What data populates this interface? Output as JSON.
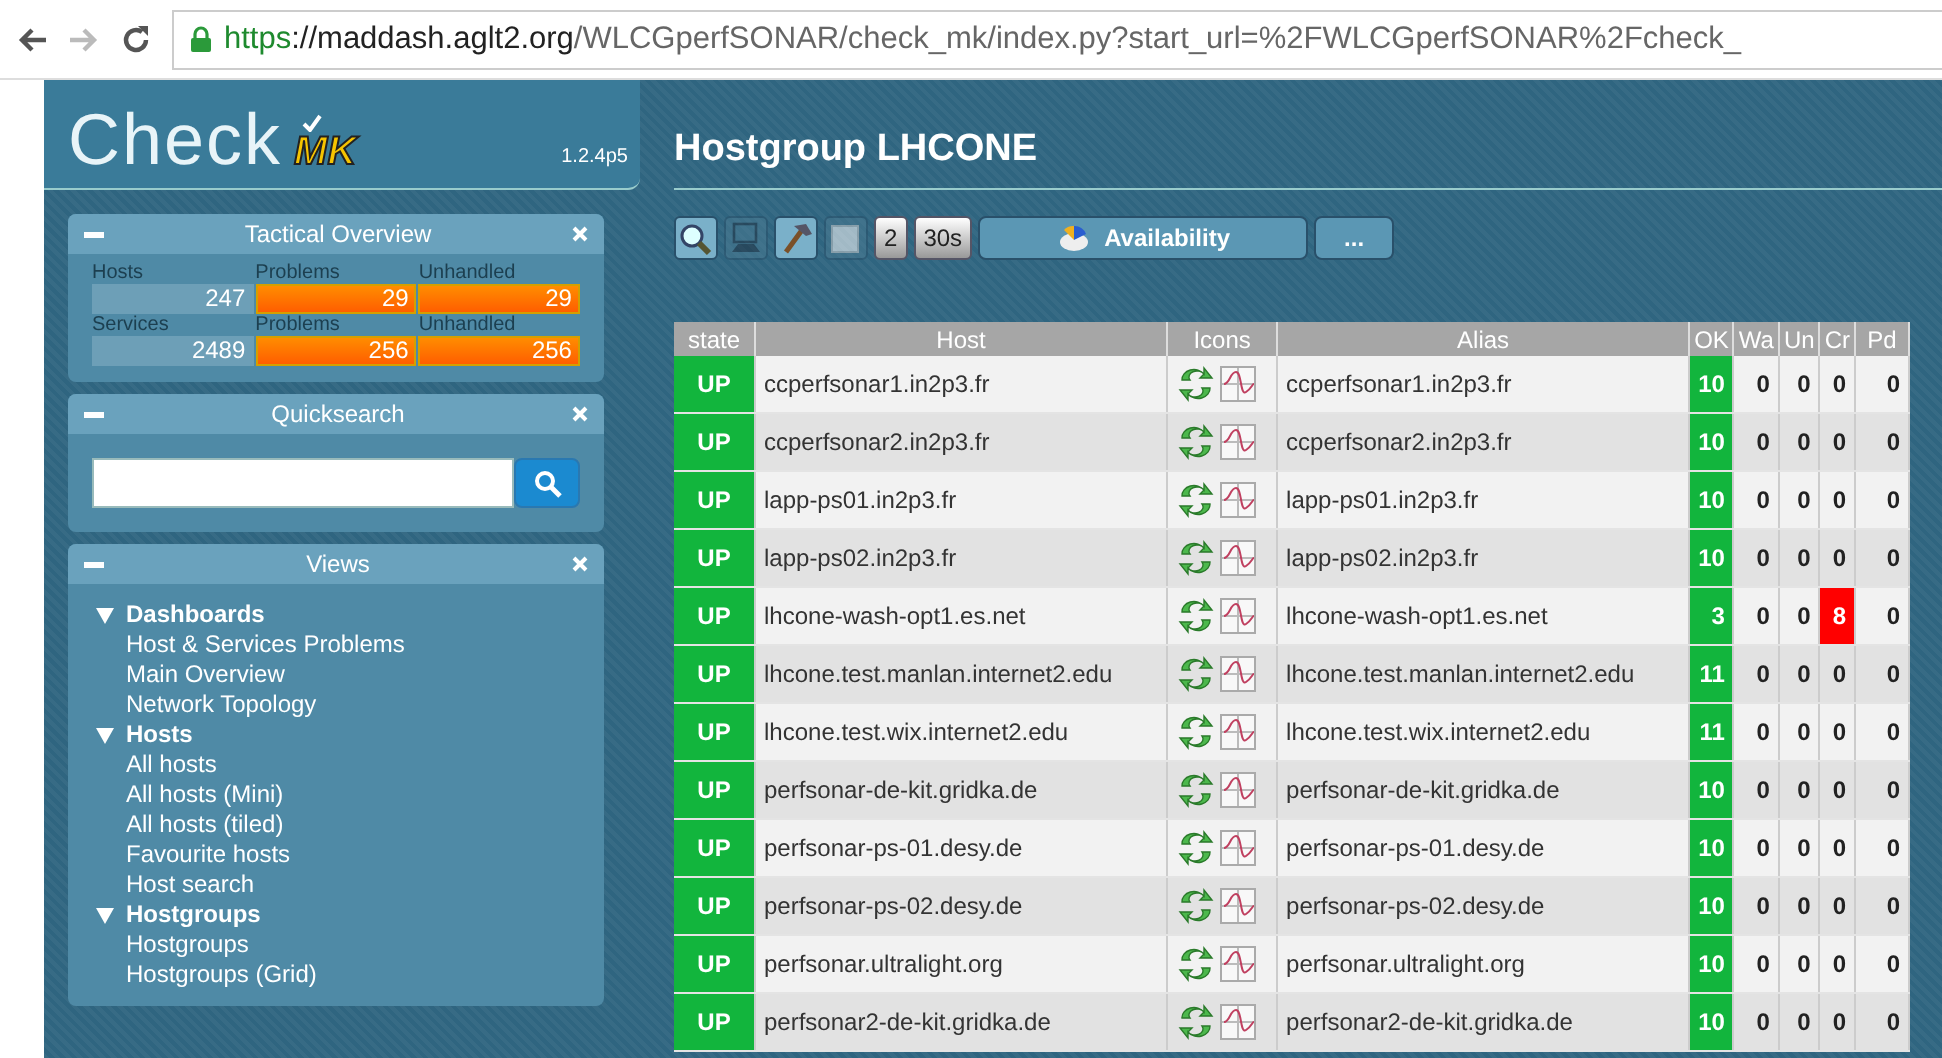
{
  "browser": {
    "back_disabled": false,
    "forward_disabled": true,
    "url": {
      "scheme": "https",
      "host": "://maddash.aglt2.org",
      "path": "/WLCGperfSONAR/check_mk/index.py?start_url=%2FWLCGperfSONAR%2Fcheck_"
    }
  },
  "logo": {
    "word": "Check",
    "mark": "MK",
    "version": "1.2.4p5"
  },
  "page_title": "Hostgroup LHCONE",
  "sidebar": {
    "tactical_overview": {
      "title": "Tactical Overview",
      "rows": [
        {
          "labels": [
            "Hosts",
            "Problems",
            "Unhandled"
          ],
          "cells": [
            {
              "value": "247",
              "alert": false
            },
            {
              "value": "29",
              "alert": true
            },
            {
              "value": "29",
              "alert": true
            }
          ]
        },
        {
          "labels": [
            "Services",
            "Problems",
            "Unhandled"
          ],
          "cells": [
            {
              "value": "2489",
              "alert": false
            },
            {
              "value": "256",
              "alert": true
            },
            {
              "value": "256",
              "alert": true
            }
          ]
        }
      ]
    },
    "quicksearch": {
      "title": "Quicksearch"
    },
    "views": {
      "title": "Views",
      "groups": [
        {
          "label": "Dashboards",
          "expanded": true,
          "children": [
            "Host & Services Problems",
            "Main Overview",
            "Network Topology"
          ]
        },
        {
          "label": "Hosts",
          "expanded": true,
          "children": [
            "All hosts",
            "All hosts (Mini)",
            "All hosts (tiled)",
            "Favourite hosts",
            "Host search"
          ]
        },
        {
          "label": "Hostgroups",
          "expanded": true,
          "children": [
            "Hostgroups",
            "Hostgroups (Grid)"
          ]
        }
      ]
    }
  },
  "toolbar": {
    "toggles": [
      {
        "kind": "search",
        "on": true
      },
      {
        "kind": "monitor",
        "on": false
      },
      {
        "kind": "hammer",
        "on": true
      },
      {
        "kind": "checkbox",
        "on": false
      }
    ],
    "refresh": [
      "2",
      "30s"
    ],
    "availability": "Availability",
    "more": "..."
  },
  "table": {
    "columns": [
      "state",
      "Host",
      "Icons",
      "Alias",
      "OK",
      "Wa",
      "Un",
      "Cr",
      "Pd"
    ],
    "rows": [
      {
        "state": {
          "label": "UP",
          "up": true
        },
        "host": "ccperfsonar1.in2p3.fr",
        "alias": "ccperfsonar1.in2p3.fr",
        "counts": [
          {
            "value": "10",
            "alert": true
          },
          {
            "value": "0",
            "alert": false
          },
          {
            "value": "0",
            "alert": false
          },
          {
            "value": "0",
            "alert": false
          },
          {
            "value": "0",
            "alert": false
          }
        ]
      },
      {
        "state": {
          "label": "UP",
          "up": true
        },
        "host": "ccperfsonar2.in2p3.fr",
        "alias": "ccperfsonar2.in2p3.fr",
        "counts": [
          {
            "value": "10",
            "alert": true
          },
          {
            "value": "0",
            "alert": false
          },
          {
            "value": "0",
            "alert": false
          },
          {
            "value": "0",
            "alert": false
          },
          {
            "value": "0",
            "alert": false
          }
        ]
      },
      {
        "state": {
          "label": "UP",
          "up": true
        },
        "host": "lapp-ps01.in2p3.fr",
        "alias": "lapp-ps01.in2p3.fr",
        "counts": [
          {
            "value": "10",
            "alert": true
          },
          {
            "value": "0",
            "alert": false
          },
          {
            "value": "0",
            "alert": false
          },
          {
            "value": "0",
            "alert": false
          },
          {
            "value": "0",
            "alert": false
          }
        ]
      },
      {
        "state": {
          "label": "UP",
          "up": true
        },
        "host": "lapp-ps02.in2p3.fr",
        "alias": "lapp-ps02.in2p3.fr",
        "counts": [
          {
            "value": "10",
            "alert": true
          },
          {
            "value": "0",
            "alert": false
          },
          {
            "value": "0",
            "alert": false
          },
          {
            "value": "0",
            "alert": false
          },
          {
            "value": "0",
            "alert": false
          }
        ]
      },
      {
        "state": {
          "label": "UP",
          "up": true
        },
        "host": "lhcone-wash-opt1.es.net",
        "alias": "lhcone-wash-opt1.es.net",
        "counts": [
          {
            "value": "3",
            "alert": true
          },
          {
            "value": "0",
            "alert": false
          },
          {
            "value": "0",
            "alert": false
          },
          {
            "value": "8",
            "alert": true
          },
          {
            "value": "0",
            "alert": false
          }
        ]
      },
      {
        "state": {
          "label": "UP",
          "up": true
        },
        "host": "lhcone.test.manlan.internet2.edu",
        "alias": "lhcone.test.manlan.internet2.edu",
        "counts": [
          {
            "value": "11",
            "alert": true
          },
          {
            "value": "0",
            "alert": false
          },
          {
            "value": "0",
            "alert": false
          },
          {
            "value": "0",
            "alert": false
          },
          {
            "value": "0",
            "alert": false
          }
        ]
      },
      {
        "state": {
          "label": "UP",
          "up": true
        },
        "host": "lhcone.test.wix.internet2.edu",
        "alias": "lhcone.test.wix.internet2.edu",
        "counts": [
          {
            "value": "11",
            "alert": true
          },
          {
            "value": "0",
            "alert": false
          },
          {
            "value": "0",
            "alert": false
          },
          {
            "value": "0",
            "alert": false
          },
          {
            "value": "0",
            "alert": false
          }
        ]
      },
      {
        "state": {
          "label": "UP",
          "up": true
        },
        "host": "perfsonar-de-kit.gridka.de",
        "alias": "perfsonar-de-kit.gridka.de",
        "counts": [
          {
            "value": "10",
            "alert": true
          },
          {
            "value": "0",
            "alert": false
          },
          {
            "value": "0",
            "alert": false
          },
          {
            "value": "0",
            "alert": false
          },
          {
            "value": "0",
            "alert": false
          }
        ]
      },
      {
        "state": {
          "label": "UP",
          "up": true
        },
        "host": "perfsonar-ps-01.desy.de",
        "alias": "perfsonar-ps-01.desy.de",
        "counts": [
          {
            "value": "10",
            "alert": true
          },
          {
            "value": "0",
            "alert": false
          },
          {
            "value": "0",
            "alert": false
          },
          {
            "value": "0",
            "alert": false
          },
          {
            "value": "0",
            "alert": false
          }
        ]
      },
      {
        "state": {
          "label": "UP",
          "up": true
        },
        "host": "perfsonar-ps-02.desy.de",
        "alias": "perfsonar-ps-02.desy.de",
        "counts": [
          {
            "value": "10",
            "alert": true
          },
          {
            "value": "0",
            "alert": false
          },
          {
            "value": "0",
            "alert": false
          },
          {
            "value": "0",
            "alert": false
          },
          {
            "value": "0",
            "alert": false
          }
        ]
      },
      {
        "state": {
          "label": "UP",
          "up": true
        },
        "host": "perfsonar.ultralight.org",
        "alias": "perfsonar.ultralight.org",
        "counts": [
          {
            "value": "10",
            "alert": true
          },
          {
            "value": "0",
            "alert": false
          },
          {
            "value": "0",
            "alert": false
          },
          {
            "value": "0",
            "alert": false
          },
          {
            "value": "0",
            "alert": false
          }
        ]
      },
      {
        "state": {
          "label": "UP",
          "up": true
        },
        "host": "perfsonar2-de-kit.gridka.de",
        "alias": "perfsonar2-de-kit.gridka.de",
        "counts": [
          {
            "value": "10",
            "alert": true
          },
          {
            "value": "0",
            "alert": false
          },
          {
            "value": "0",
            "alert": false
          },
          {
            "value": "0",
            "alert": false
          },
          {
            "value": "0",
            "alert": false
          }
        ]
      }
    ]
  }
}
